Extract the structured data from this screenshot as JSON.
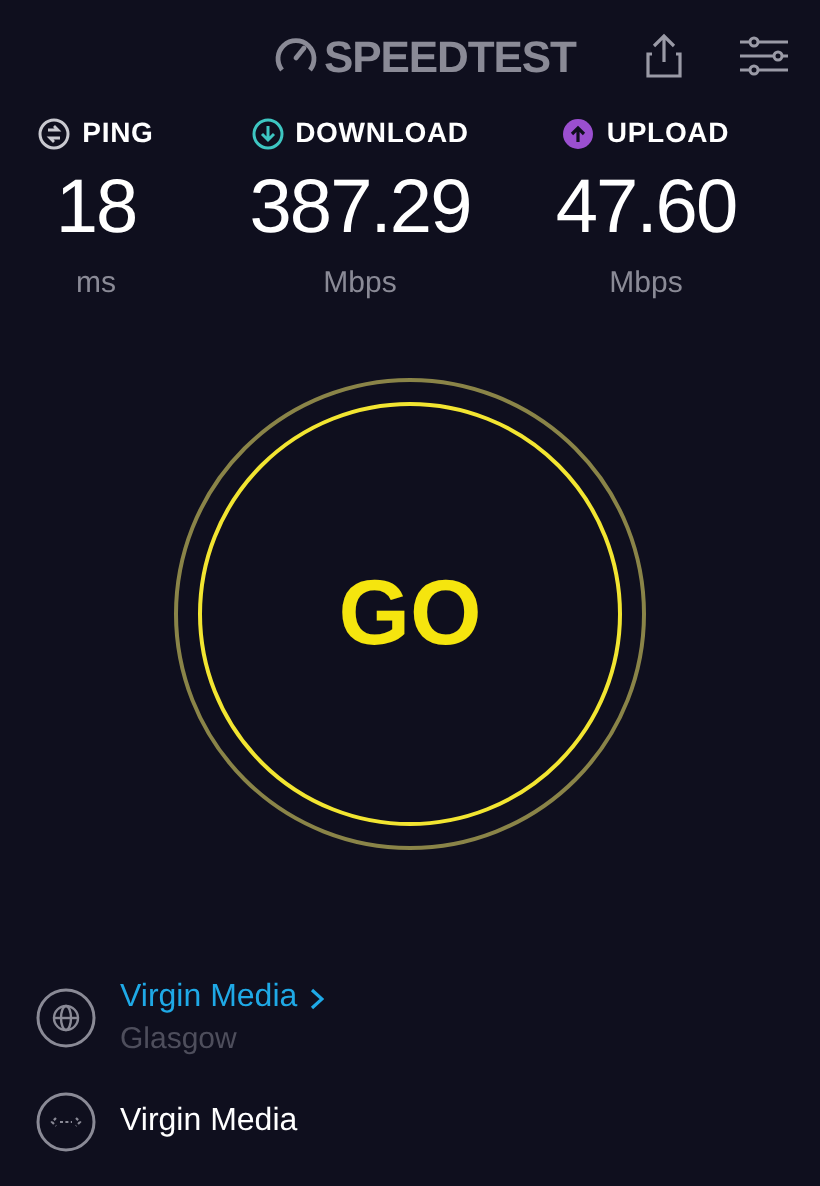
{
  "header": {
    "logo": "SPEEDTEST"
  },
  "metrics": [
    {
      "kind": "ping",
      "label": "PING",
      "value": "18",
      "unit": "ms"
    },
    {
      "kind": "download",
      "label": "DOWNLOAD",
      "value": "387.29",
      "unit": "Mbps"
    },
    {
      "kind": "upload",
      "label": "UPLOAD",
      "value": "47.60",
      "unit": "Mbps"
    }
  ],
  "go_button": {
    "label": "GO"
  },
  "server": {
    "name": "Virgin Media",
    "location": "Glasgow"
  },
  "provider": {
    "name": "Virgin Media"
  }
}
